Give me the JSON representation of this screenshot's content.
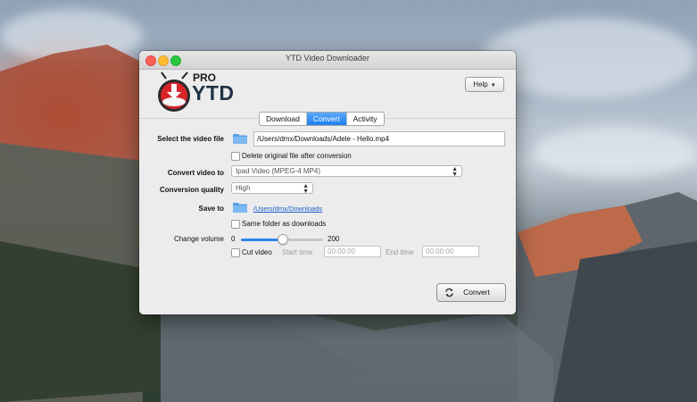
{
  "window": {
    "title": "YTD Video Downloader"
  },
  "logo": {
    "pro": "PRO",
    "name": "YTD"
  },
  "help": {
    "label": "Help"
  },
  "tabs": [
    {
      "label": "Download",
      "active": false
    },
    {
      "label": "Convert",
      "active": true
    },
    {
      "label": "Activity",
      "active": false
    }
  ],
  "form": {
    "select_file_label": "Select the video file",
    "file_path": "/Users/dmx/Downloads/Adele - Hello.mp4",
    "delete_original_label": "Delete original file after conversion",
    "delete_original_checked": false,
    "convert_to_label": "Convert video to",
    "convert_to_value": "Ipad Video (MPEG-4 MP4)",
    "quality_label": "Conversion quality",
    "quality_value": "High",
    "save_to_label": "Save to",
    "save_to_path": "/Users/dmx/Downloads",
    "same_folder_label": "Same folder as downloads",
    "same_folder_checked": false,
    "volume_label": "Change volume",
    "volume_min": "0",
    "volume_max": "200",
    "volume_value": 100,
    "cut_video_label": "Cut video",
    "cut_video_checked": false,
    "start_time_label": "Start time",
    "start_time_value": "00:00:00",
    "end_time_label": "End time",
    "end_time_value": "00:00:00"
  },
  "convert_button": {
    "label": "Convert"
  },
  "colors": {
    "accent": "#1d7ef0",
    "link": "#1a5fc8",
    "logo_red": "#d8252a"
  }
}
